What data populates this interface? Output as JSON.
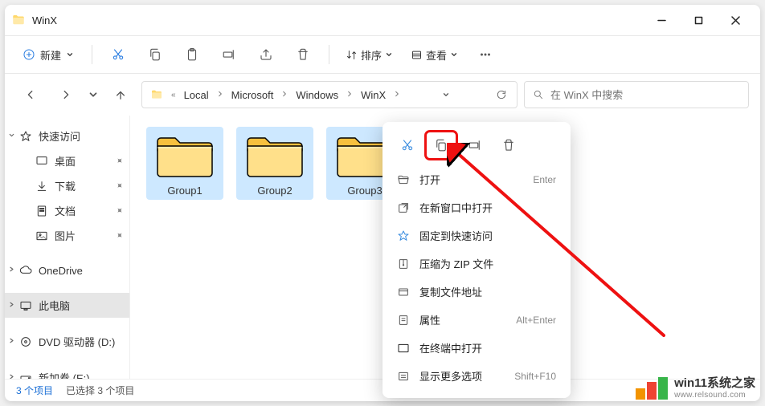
{
  "window": {
    "title": "WinX"
  },
  "toolbar": {
    "new_label": "新建",
    "sort_label": "排序",
    "view_label": "查看"
  },
  "breadcrumbs": [
    "Local",
    "Microsoft",
    "Windows",
    "WinX"
  ],
  "search": {
    "placeholder": "在 WinX 中搜索"
  },
  "sidebar": {
    "quick": "快速访问",
    "desktop": "桌面",
    "downloads": "下载",
    "documents": "文档",
    "pictures": "图片",
    "onedrive": "OneDrive",
    "thispc": "此电脑",
    "dvd": "DVD 驱动器 (D:)",
    "volume": "新加卷 (E:)"
  },
  "folders": [
    "Group1",
    "Group2",
    "Group3"
  ],
  "context": {
    "open": "打开",
    "open_shortcut": "Enter",
    "openwin": "在新窗口中打开",
    "pin": "固定到快速访问",
    "zip": "压缩为 ZIP 文件",
    "copypath": "复制文件地址",
    "props": "属性",
    "props_shortcut": "Alt+Enter",
    "terminal": "在终端中打开",
    "more": "显示更多选项",
    "more_shortcut": "Shift+F10"
  },
  "status": {
    "count": "3 个项目",
    "selected": "已选择 3 个项目"
  },
  "watermark": {
    "title": "win11系统之家",
    "url": "www.relsound.com"
  }
}
